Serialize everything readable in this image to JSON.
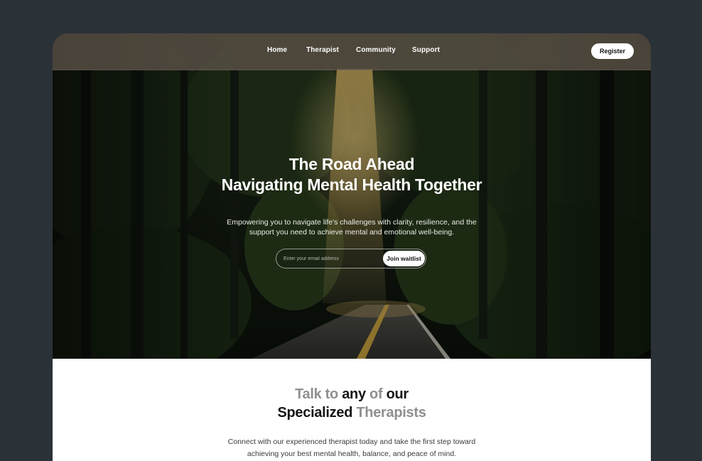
{
  "nav": {
    "links": [
      "Home",
      "Therapist",
      "Community",
      "Support"
    ],
    "register_label": "Register"
  },
  "hero": {
    "title_line1": "The Road Ahead",
    "title_line2": "Navigating Mental Health Together",
    "subtitle_line1": "Empowering you to navigate life's challenges with clarity, resilience, and the",
    "subtitle_line2": "support you need to achieve mental and emotional well-being.",
    "email_placeholder": "Enter your email address",
    "join_label": "Join waitlist"
  },
  "section": {
    "title_line1": [
      "Talk to",
      "any",
      "of",
      "our"
    ],
    "title_line2": [
      "Specialized",
      "Therapists"
    ],
    "body_line1": "Connect with our experienced therapist today and take the first step toward",
    "body_line2": "achieving your best mental health, balance, and peace of mind."
  },
  "colors": {
    "page_bg": "#2b3237",
    "accent_grey": "#8f8f8f",
    "forest_dark": "#0d140d"
  }
}
